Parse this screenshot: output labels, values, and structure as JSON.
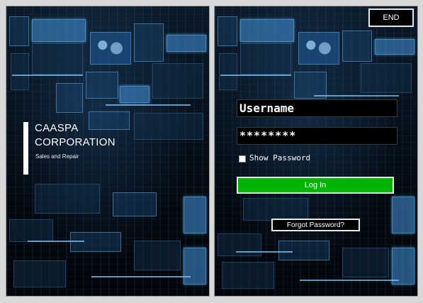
{
  "brand": {
    "line1": "CAASPA",
    "line2": "CORPORATION",
    "tagline": "Sales and Repair"
  },
  "login": {
    "end_label": "END",
    "username_value": "Username",
    "password_value": "********",
    "show_password_label": "Show Password",
    "show_password_checked": false,
    "login_label": "Log In",
    "forgot_label": "Forgot Password?"
  },
  "colors": {
    "login_button": "#00b400",
    "panel_background": "#03070d",
    "border": "#e8e8e8"
  }
}
